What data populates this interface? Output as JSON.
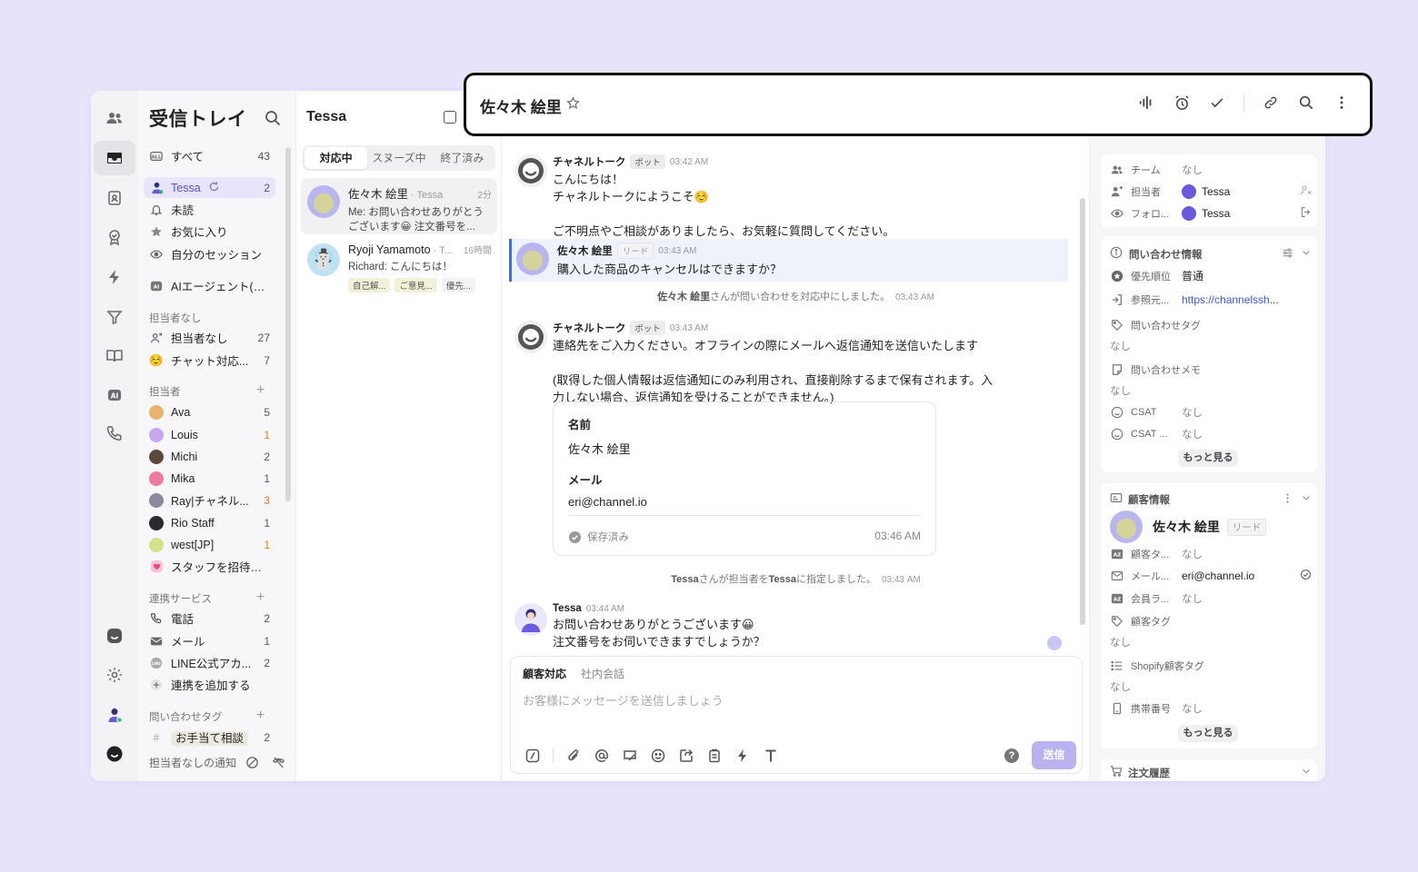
{
  "sidebar": {
    "title": "受信トレイ",
    "items": [
      {
        "label": "すべて",
        "count": "43"
      },
      {
        "label": "Tessa",
        "count": "2"
      },
      {
        "label": "未読",
        "count": ""
      },
      {
        "label": "お気に入り",
        "count": ""
      },
      {
        "label": "自分のセッション",
        "count": ""
      },
      {
        "label": "AIエージェント(A...",
        "count": ""
      }
    ],
    "section_unassigned": "担当者なし",
    "unassigned": [
      {
        "label": "担当者なし",
        "count": "27"
      },
      {
        "label": "チャット対応...",
        "count": "7"
      }
    ],
    "section_assignees": "担当者",
    "assignees": [
      {
        "label": "Ava",
        "count": "5"
      },
      {
        "label": "Louis",
        "count": "1"
      },
      {
        "label": "Michi",
        "count": "2"
      },
      {
        "label": "Mika",
        "count": "1"
      },
      {
        "label": "Ray|チャネル...",
        "count": "3"
      },
      {
        "label": "Rio Staff",
        "count": "1"
      },
      {
        "label": "west[JP]",
        "count": "1"
      },
      {
        "label": "スタッフを招待する",
        "count": ""
      }
    ],
    "section_integrations": "連携サービス",
    "integrations": [
      {
        "label": "電話",
        "count": "2"
      },
      {
        "label": "メール",
        "count": "1"
      },
      {
        "label": "LINE公式アカ...",
        "count": "2"
      },
      {
        "label": "連携を追加する",
        "count": ""
      }
    ],
    "section_tags": "問い合わせタグ",
    "tags": [
      {
        "label": "お手当て相談",
        "count": "2"
      }
    ],
    "bottom_label": "担当者なしの通知",
    "colors": {
      "active_bg": "#e7e5fb",
      "active_text": "#5b4fd6",
      "orange_count": "#f07a00"
    }
  },
  "list": {
    "title": "Tessa",
    "tabs": [
      "対応中",
      "スヌーズ中",
      "終了済み"
    ],
    "conversations": [
      {
        "name": "佐々木 絵里",
        "meta": "· Tessa",
        "time": "2分",
        "body": "Me: お問い合わせありがとうございます😀 注文番号を...",
        "tags": []
      },
      {
        "name": "Ryoji Yamamoto",
        "meta": "· T...",
        "time": "16時間",
        "body": "Richard: こんにちは！",
        "tags": [
          "自己解...",
          "ご意見...",
          "優先..."
        ]
      }
    ]
  },
  "header": {
    "title": "佐々木 絵里",
    "icons": [
      "voice-icon",
      "alarm-icon",
      "check-icon",
      "link-icon",
      "search-icon",
      "more-icon"
    ]
  },
  "chat": {
    "messages": [
      {
        "name": "チャネルトーク",
        "badge": "ボット",
        "time": "03:42 AM",
        "text": "こんにちは！\nチャネルトークにようこそ☺️\n\nご不明点やご相談がありましたら、お気軽に質問してください。"
      },
      {
        "name": "佐々木 絵里",
        "badge": "リード",
        "time": "03:43 AM",
        "text": "購入した商品のキャンセルはできますか？"
      },
      {
        "name": "チャネルトーク",
        "badge": "ボット",
        "time": "03:43 AM",
        "text": "連絡先をご入力ください。オフラインの際にメールへ返信通知を送信いたします\n\n(取得した個人情報は返信通知にのみ利用され、直接削除するまで保有されます。入\n力しない場合、返信通知を受けることができません。)"
      },
      {
        "name": "Tessa",
        "badge": "",
        "time": "03:44 AM",
        "text": "お問い合わせありがとうございます😀\n注文番号をお伺いできますでしょうか？"
      }
    ],
    "system_1": {
      "who": "佐々木 絵里",
      "rest": "さんが問い合わせを対応中にしました。",
      "time": "03:43 AM"
    },
    "system_2": {
      "who": "Tessa",
      "mid": "さんが担当者を",
      "who2": "Tessa",
      "rest": "に指定しました。",
      "time": "03:43 AM"
    },
    "form_card": {
      "name_label": "名前",
      "name_value": "佐々木 絵里",
      "email_label": "メール",
      "email_value": "eri@channel.io",
      "saved_label": "保存済み",
      "saved_time": "03:46 AM"
    },
    "composer": {
      "tab_active": "顧客対応",
      "tab_inactive": "社内会話",
      "placeholder": "お客様にメッセージを送信しましょう",
      "send_label": "送信",
      "help_label": "?"
    }
  },
  "right_panel": {
    "team": {
      "label": "チーム",
      "value": "なし"
    },
    "assignee": {
      "label": "担当者",
      "value": "Tessa"
    },
    "follower": {
      "label": "フォロ...",
      "value": "Tessa"
    },
    "inquiry_header": "問い合わせ情報",
    "priority": {
      "label": "優先順位",
      "value": "普通"
    },
    "referrer": {
      "label": "参照元...",
      "value": "https://channelssh..."
    },
    "inquiry_tag": {
      "label": "問い合わせタグ",
      "value": "なし"
    },
    "inquiry_memo": {
      "label": "問い合わせメモ",
      "value": "なし"
    },
    "csat1": {
      "label": "CSAT",
      "value": "なし"
    },
    "csat2": {
      "label": "CSAT ...",
      "value": "なし"
    },
    "more_label": "もっと見る",
    "customer_header": "顧客情報",
    "customer_name": "佐々木 絵里",
    "customer_badge": "リード",
    "customer_tag_field": {
      "label": "顧客タ...",
      "value": "なし"
    },
    "mail_field": {
      "label": "メール...",
      "value": "eri@channel.io"
    },
    "member_field": {
      "label": "会員ラ...",
      "value": "なし"
    },
    "customer_tag": {
      "label": "顧客タグ",
      "value": "なし"
    },
    "shopify_tag": {
      "label": "Shopify顧客タグ",
      "value": "なし"
    },
    "phone": {
      "label": "携帯番号",
      "value": "なし"
    },
    "more_label_2": "もっと見る",
    "order_history": "注文履歴"
  },
  "colors": {
    "page_bg": "#e6e4fb",
    "accent": "#5b4fd6",
    "send_btn": "#b9b2ee",
    "highlight_border": "#3b6fe0",
    "link": "#3b5bdb"
  }
}
